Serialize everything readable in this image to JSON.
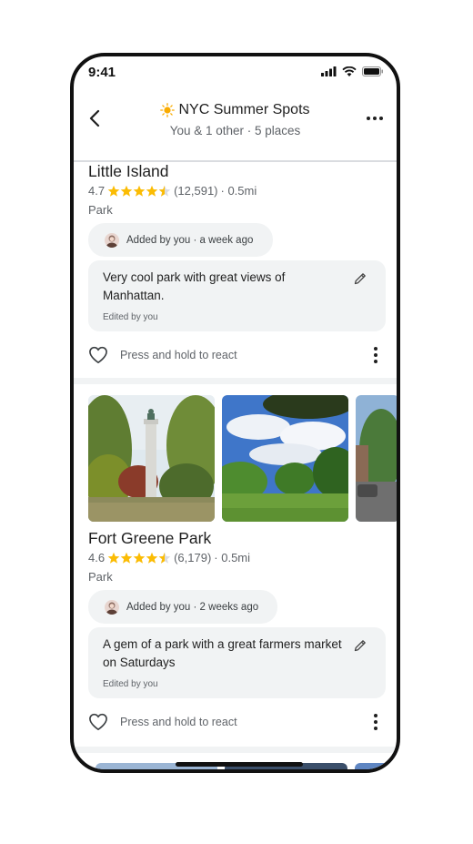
{
  "status_bar": {
    "time": "9:41"
  },
  "header": {
    "title": "NYC Summer Spots",
    "title_emoji": "☀",
    "subtitle": "You & 1 other · 5 places"
  },
  "places": [
    {
      "name": "Little Island",
      "rating": "4.7",
      "reviews": "(12,591)",
      "distance": "· 0.5mi",
      "type": "Park",
      "added_by": "Added by you · a week ago",
      "note": "Very cool park with great views of Manhattan.",
      "edited": "Edited by you",
      "react_label": "Press and hold to react"
    },
    {
      "name": "Fort Greene Park",
      "rating": "4.6",
      "reviews": "(6,179)",
      "distance": "· 0.5mi",
      "type": "Park",
      "added_by": "Added by you · 2 weeks ago",
      "note": "A gem of a park with a great farmers market on Saturdays",
      "edited": "Edited by you",
      "react_label": "Press and hold to react"
    }
  ],
  "colors": {
    "star": "#fbbc04",
    "chip_bg": "#f1f3f4",
    "secondary_text": "#5f6368"
  }
}
